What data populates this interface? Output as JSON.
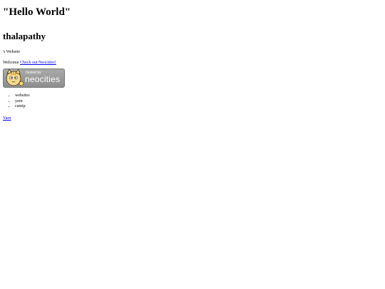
{
  "hello_title": "\"Hello World\"",
  "name_title": "thalapathy",
  "subtitle": "'s Website",
  "welcome": {
    "text": "Welcome ",
    "link_text": "Check out Neocities!"
  },
  "badge": {
    "hosted_text": "hosted by",
    "brand_text": "neocities",
    "icon": "neocities-cat-icon",
    "background_color": "#999999"
  },
  "list_items": [
    "websites",
    "yarn",
    "catnip"
  ],
  "yarn_link": "Yarn",
  "colors": {
    "link": "#0000ee",
    "text": "#000000"
  }
}
